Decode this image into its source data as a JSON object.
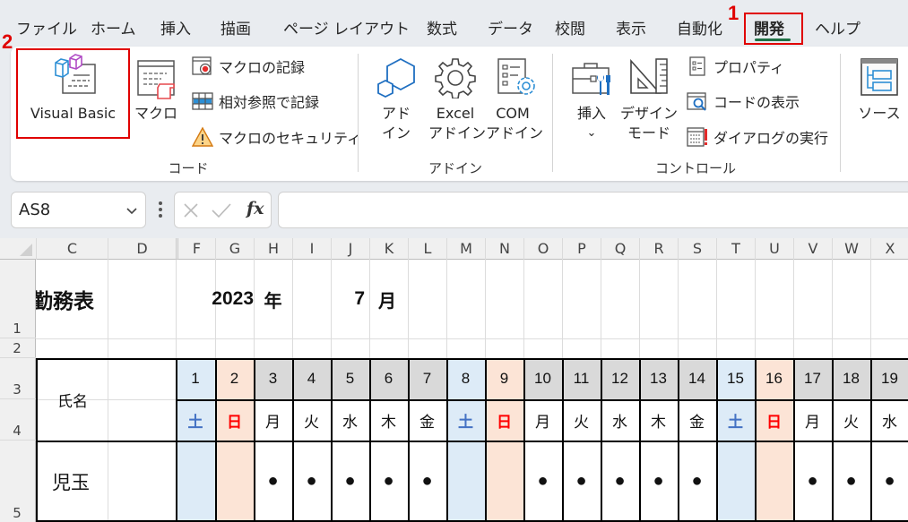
{
  "menu": {
    "tabs": [
      {
        "label": "ファイル"
      },
      {
        "label": "ホーム"
      },
      {
        "label": "挿入"
      },
      {
        "label": "描画"
      },
      {
        "label": "ページ レイアウト"
      },
      {
        "label": "数式"
      },
      {
        "label": "データ"
      },
      {
        "label": "校閲"
      },
      {
        "label": "表示"
      },
      {
        "label": "自動化"
      },
      {
        "label": "開発",
        "active": true
      },
      {
        "label": "ヘルプ"
      }
    ]
  },
  "callouts": {
    "step1": "1",
    "step2": "2"
  },
  "ribbon": {
    "code_group": {
      "label": "コード",
      "visual_basic": "Visual Basic",
      "macro": "マクロ",
      "record_macro": "マクロの記録",
      "relative_ref": "相対参照で記録",
      "macro_security": "マクロのセキュリティ"
    },
    "addin_group": {
      "label": "アドイン",
      "addin_line1": "アド",
      "addin_line2": "イン",
      "excel_addin_line1": "Excel",
      "excel_addin_line2": "アドイン",
      "com_addin_line1": "COM",
      "com_addin_line2": "アドイン"
    },
    "control_group": {
      "label": "コントロール",
      "insert": "挿入",
      "insert_chevron": "⌄",
      "design_mode_line1": "デザイン",
      "design_mode_line2": "モード",
      "properties": "プロパティ",
      "view_code": "コードの表示",
      "run_dialog": "ダイアログの実行"
    },
    "xml_group": {
      "source": "ソース"
    }
  },
  "formula_bar": {
    "name_box": "AS8",
    "cancel_icon": "✕",
    "enter_icon": "✓",
    "fx_label": "fx",
    "formula_value": ""
  },
  "sheet": {
    "columns": [
      "C",
      "D",
      "F",
      "G",
      "H",
      "I",
      "J",
      "K",
      "L",
      "M",
      "N",
      "O",
      "P",
      "Q",
      "R",
      "S",
      "T",
      "U",
      "V",
      "W",
      "X"
    ],
    "rows": [
      "1",
      "2",
      "3",
      "4",
      "5"
    ],
    "title": "勤務表",
    "year": "2023",
    "year_unit": "年",
    "month": "7",
    "month_unit": "月",
    "name_header": "氏名",
    "days": [
      {
        "day": "1",
        "weekday": "土",
        "type": "sat",
        "mark": ""
      },
      {
        "day": "2",
        "weekday": "日",
        "type": "sun",
        "mark": ""
      },
      {
        "day": "3",
        "weekday": "月",
        "type": "weekday",
        "mark": "●"
      },
      {
        "day": "4",
        "weekday": "火",
        "type": "weekday",
        "mark": "●"
      },
      {
        "day": "5",
        "weekday": "水",
        "type": "weekday",
        "mark": "●"
      },
      {
        "day": "6",
        "weekday": "木",
        "type": "weekday",
        "mark": "●"
      },
      {
        "day": "7",
        "weekday": "金",
        "type": "weekday",
        "mark": "●"
      },
      {
        "day": "8",
        "weekday": "土",
        "type": "sat",
        "mark": ""
      },
      {
        "day": "9",
        "weekday": "日",
        "type": "sun",
        "mark": ""
      },
      {
        "day": "10",
        "weekday": "月",
        "type": "weekday",
        "mark": "●"
      },
      {
        "day": "11",
        "weekday": "火",
        "type": "weekday",
        "mark": "●"
      },
      {
        "day": "12",
        "weekday": "水",
        "type": "weekday",
        "mark": "●"
      },
      {
        "day": "13",
        "weekday": "木",
        "type": "weekday",
        "mark": "●"
      },
      {
        "day": "14",
        "weekday": "金",
        "type": "weekday",
        "mark": "●"
      },
      {
        "day": "15",
        "weekday": "土",
        "type": "sat",
        "mark": ""
      },
      {
        "day": "16",
        "weekday": "日",
        "type": "sun",
        "mark": ""
      },
      {
        "day": "17",
        "weekday": "月",
        "type": "weekday",
        "mark": "●"
      },
      {
        "day": "18",
        "weekday": "火",
        "type": "weekday",
        "mark": "●"
      },
      {
        "day": "19",
        "weekday": "水",
        "type": "weekday",
        "mark": "●"
      }
    ],
    "employees": [
      {
        "name": "児玉"
      }
    ]
  },
  "colors": {
    "accent_green": "#1e7145",
    "callout_red": "#e00000",
    "saturday_fill": "#ddebf7",
    "sunday_fill": "#fce4d6",
    "weekday_header_fill": "#d9d9d9",
    "saturday_text": "#4472c4",
    "sunday_text": "#ff0000"
  }
}
